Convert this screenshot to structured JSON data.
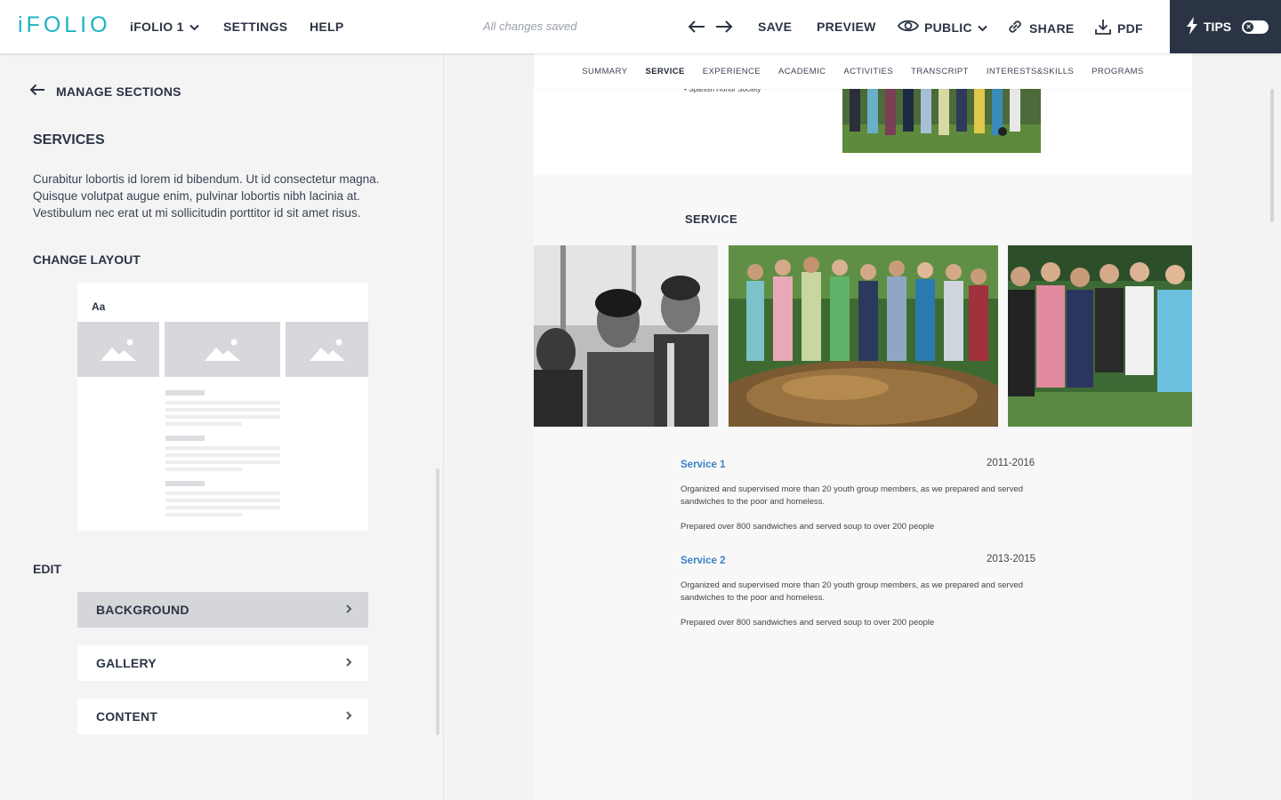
{
  "app": {
    "logo": "iFOLIO",
    "project_name": "iFOLIO 1",
    "menu": {
      "settings": "SETTINGS",
      "help": "HELP"
    },
    "status": "All changes saved",
    "actions": {
      "save": "SAVE",
      "preview": "PREVIEW",
      "visibility": "PUBLIC",
      "share": "SHARE",
      "pdf": "PDF"
    },
    "tips": {
      "label": "TIPS",
      "toggle_mark": "×"
    },
    "colors": {
      "brand": "#1ab3c6",
      "dark": "#2b3444",
      "link_blue": "#3b82c4"
    }
  },
  "sidebar": {
    "back_label": "MANAGE SECTIONS",
    "section_title": "SERVICES",
    "description": "Curabitur lobortis id lorem id bibendum. Ut id consectetur magna. Quisque volutpat augue enim, pulvinar lobortis nibh lacinia at. Vestibulum nec erat ut mi sollicitudin porttitor id sit amet risus.",
    "change_layout_label": "CHANGE LAYOUT",
    "layout_preview_text": "Aa",
    "edit_label": "EDIT",
    "edit_items": [
      {
        "label": "BACKGROUND",
        "active": true
      },
      {
        "label": "GALLERY",
        "active": false
      },
      {
        "label": "CONTENT",
        "active": false
      }
    ]
  },
  "preview": {
    "nav": [
      "SUMMARY",
      "SERVICE",
      "EXPERIENCE",
      "ACADEMIC",
      "ACTIVITIES",
      "TRANSCRIPT",
      "INTERESTS&SKILLS",
      "PROGRAMS"
    ],
    "active_nav": "SERVICE",
    "top_bullet": "• Spanish Honor Society",
    "service_heading": "SERVICE",
    "entries": [
      {
        "title": "Service 1",
        "date": "2011-2016",
        "text1": "Organized and supervised more than 20 youth group members, as we prepared and served sandwiches to the poor and homeless.",
        "text2": "Prepared over 800 sandwiches and served soup to over 200 people"
      },
      {
        "title": "Service 2",
        "date": "2013-2015",
        "text1": "Organized and supervised more than 20 youth group members, as we prepared and served sandwiches to the poor and homeless.",
        "text2": "Prepared over 800 sandwiches and served soup to over 200 people"
      }
    ]
  }
}
